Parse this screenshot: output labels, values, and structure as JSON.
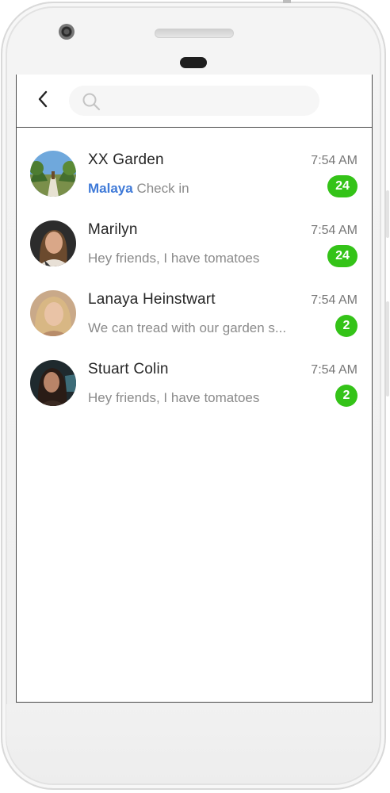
{
  "header": {
    "back_label": "Back",
    "search_placeholder": ""
  },
  "chats": [
    {
      "name": "XX Garden",
      "time": "7:54 AM",
      "sender": "Malaya",
      "message": "Check in",
      "unread": "24",
      "avatar": "garden-photo"
    },
    {
      "name": "Marilyn",
      "time": "7:54 AM",
      "sender": "",
      "message": "Hey friends, I have tomatoes",
      "unread": "24",
      "avatar": "person-photo"
    },
    {
      "name": "Lanaya Heinstwart",
      "time": "7:54 AM",
      "sender": "",
      "message": "We can tread with our garden s...",
      "unread": "2",
      "avatar": "person-photo"
    },
    {
      "name": "Stuart Colin",
      "time": "7:54 AM",
      "sender": "",
      "message": "Hey friends, I have tomatoes",
      "unread": "2",
      "avatar": "person-photo"
    }
  ],
  "colors": {
    "badge": "#34c318",
    "sender": "#3f7ad8"
  }
}
